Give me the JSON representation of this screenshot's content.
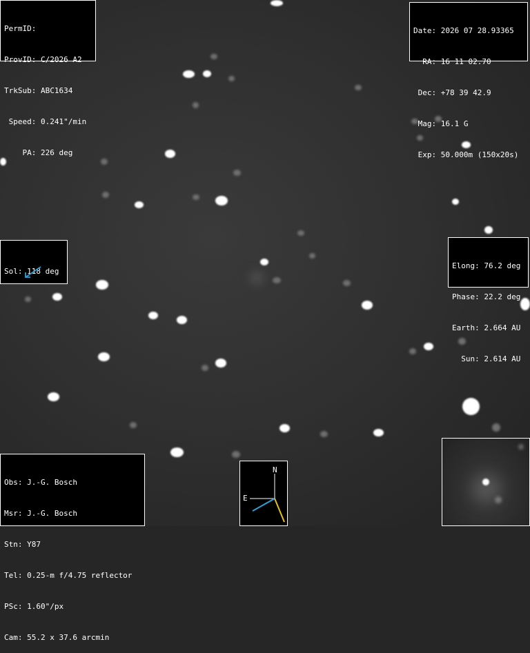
{
  "top_left": {
    "permid": "PermID:",
    "provid": "ProvID: C/2026 A2",
    "trksub": "TrkSub: ABC1634",
    "speed": " Speed: 0.241\"/min",
    "pa": "    PA: 226 deg"
  },
  "top_right": {
    "date": "Date: 2026 07 28.93365",
    "ra": "  RA: 16 11 02.70",
    "dec": " Dec: +78 39 42.9",
    "mag": " Mag: 16.1 G",
    "exp": " Exp: 50.000m (150x20s)"
  },
  "sol": {
    "label": "Sol: 118 deg",
    "arrow_color": "#2ea0d8"
  },
  "mid_right": {
    "elong": "Elong: 76.2 deg",
    "phase": "Phase: 22.2 deg",
    "earth": "Earth: 2.664 AU",
    "sun": "  Sun: 2.614 AU"
  },
  "bottom_left": {
    "obs": "Obs: J.-G. Bosch",
    "msr": "Msr: J.-G. Bosch",
    "stn": "Stn: Y87",
    "tel": "Tel: 0.25-m f/4.75 reflector",
    "psc": "PSc: 1.60\"/px",
    "cam": "Cam: 55.2 x 37.6 arcmin"
  },
  "compass": {
    "north": "N",
    "east": "E",
    "blue": "#2ea0d8",
    "yellow": "#e8c020"
  }
}
